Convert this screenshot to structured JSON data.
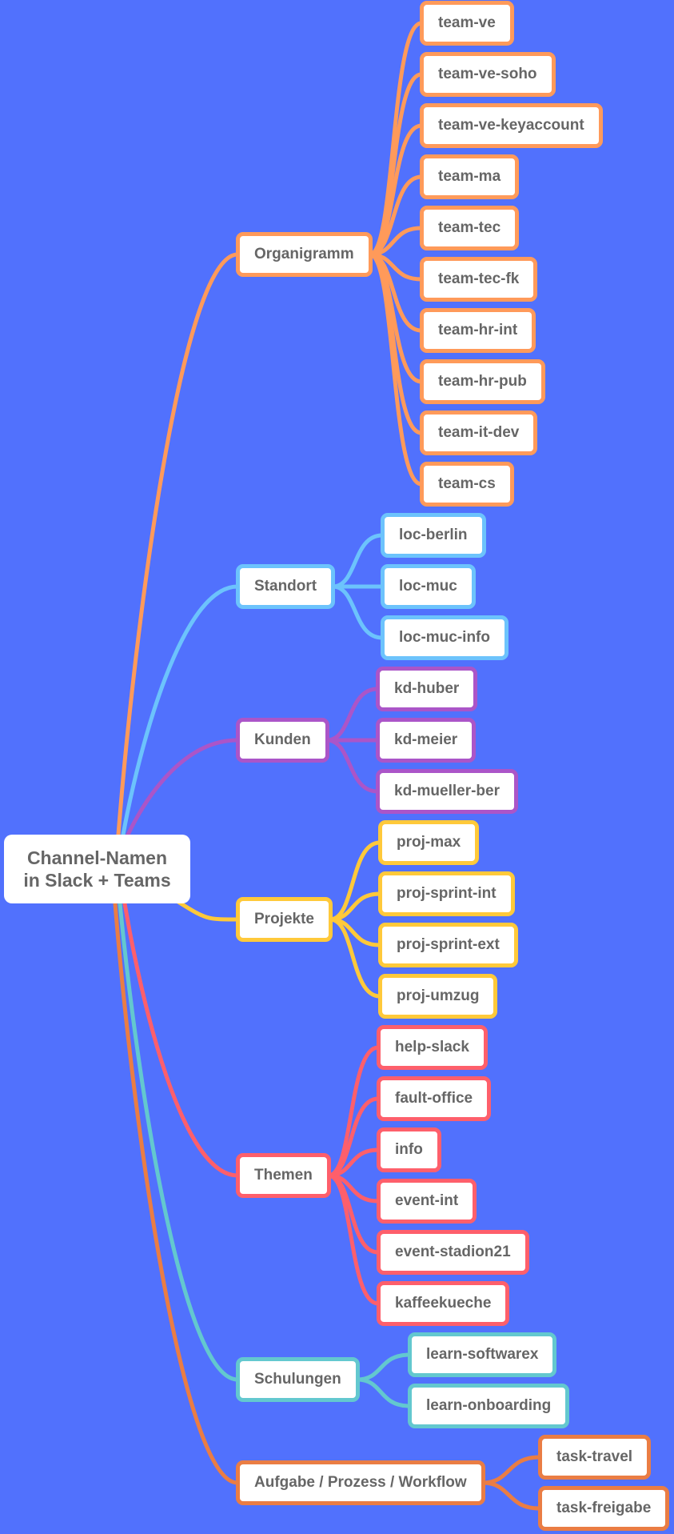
{
  "root": {
    "line1": "Channel-Namen",
    "line2": "in Slack + Teams"
  },
  "branches": [
    {
      "label": "Organigramm",
      "color": "#ff9a5a",
      "children": [
        "team-ve",
        "team-ve-soho",
        "team-ve-keyaccount",
        "team-ma",
        "team-tec",
        "team-tec-fk",
        "team-hr-int",
        "team-hr-pub",
        "team-it-dev",
        "team-cs"
      ]
    },
    {
      "label": "Standort",
      "color": "#6cc3fc",
      "children": [
        "loc-berlin",
        "loc-muc",
        "loc-muc-info"
      ]
    },
    {
      "label": "Kunden",
      "color": "#ab55c8",
      "children": [
        "kd-huber",
        "kd-meier",
        "kd-mueller-ber"
      ]
    },
    {
      "label": "Projekte",
      "color": "#ffc93a",
      "children": [
        "proj-max",
        "proj-sprint-int",
        "proj-sprint-ext",
        "proj-umzug"
      ]
    },
    {
      "label": "Themen",
      "color": "#fe5f6b",
      "children": [
        "help-slack",
        "fault-office",
        "info",
        "event-int",
        "event-stadion21",
        "kaffeekueche"
      ]
    },
    {
      "label": "Schulungen",
      "color": "#63c8cf",
      "children": [
        "learn-softwarex",
        "learn-onboarding"
      ]
    },
    {
      "label": "Aufgabe / Prozess / Workflow",
      "color": "#ea7d44",
      "children": [
        "task-travel",
        "task-freigabe"
      ]
    }
  ]
}
